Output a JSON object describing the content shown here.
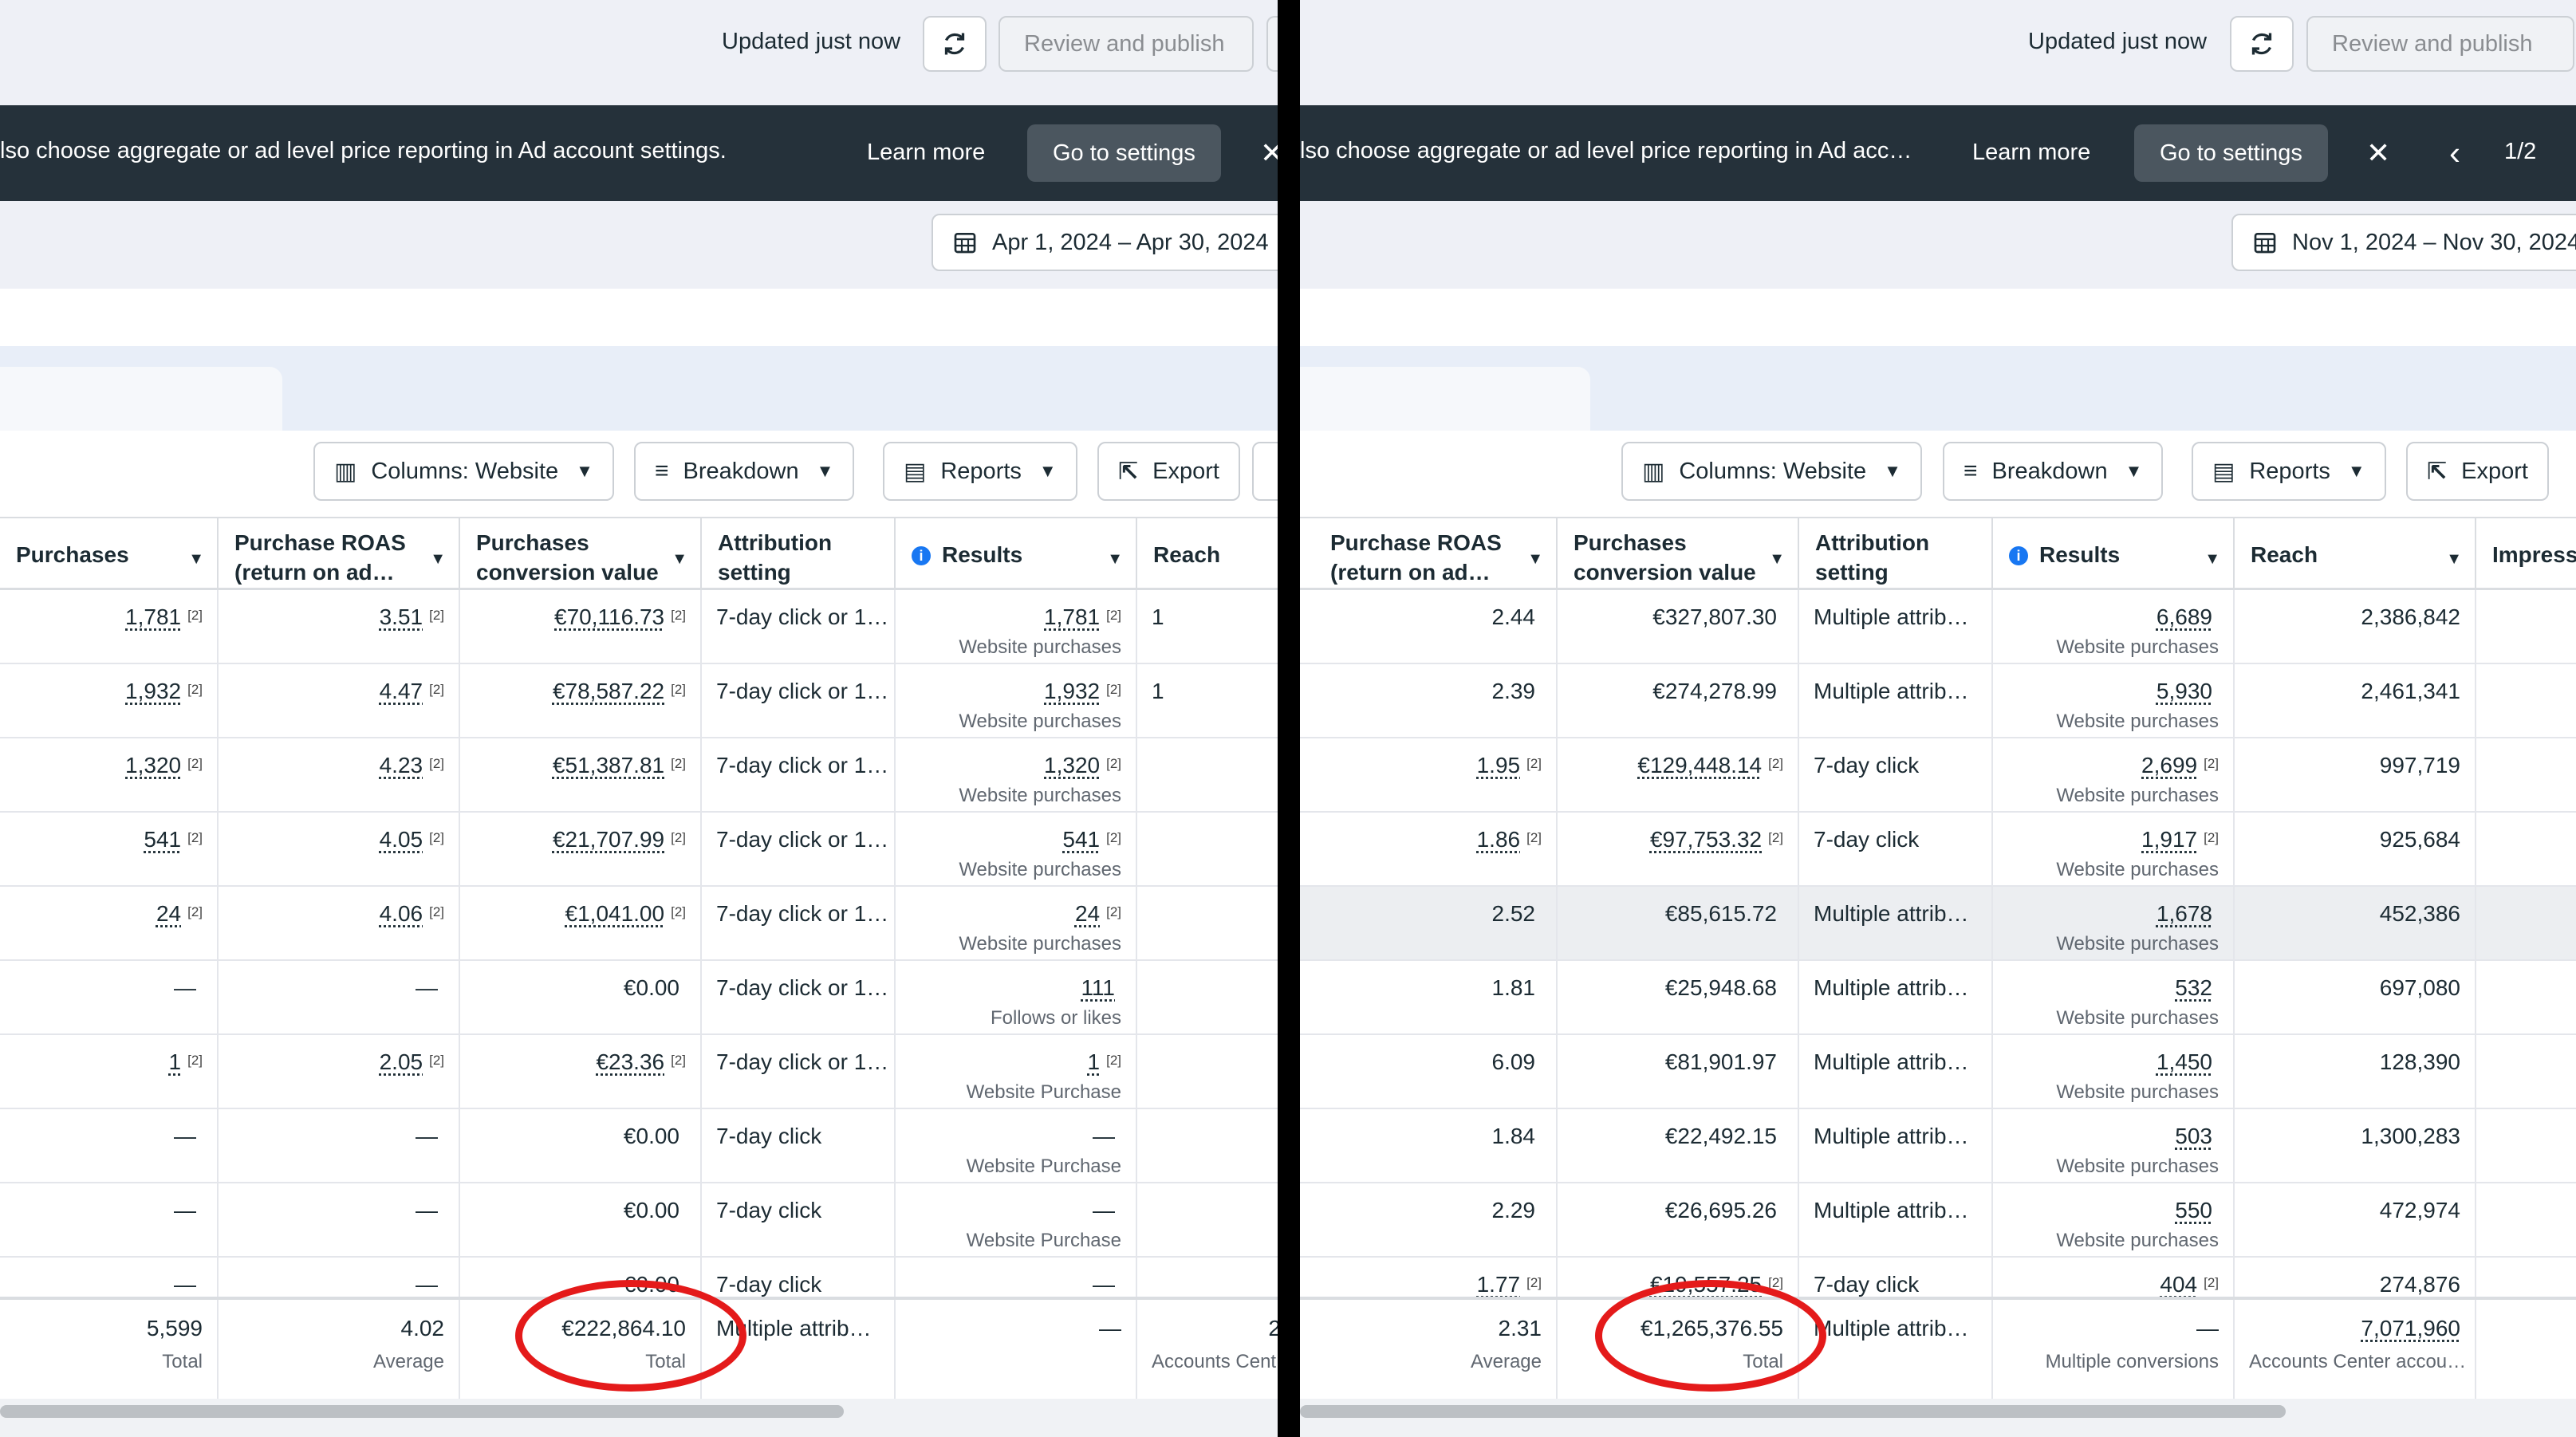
{
  "left": {
    "header": {
      "updated": "Updated just now",
      "publish": "Review and publish"
    },
    "banner": {
      "text": "lso choose aggregate or ad level price reporting in Ad account settings.",
      "learn_more": "Learn more",
      "go_to_settings": "Go to settings",
      "close": "✕"
    },
    "date_range": "Apr 1, 2024 – Apr 30, 2024",
    "toolbar": {
      "columns": "Columns: Website",
      "breakdown": "Breakdown",
      "reports": "Reports",
      "export": "Export"
    },
    "columns": {
      "purchases": "Purchases",
      "roas": "Purchase ROAS (return on ad…",
      "conv_value": "Purchases conversion value",
      "attribution": "Attribution setting",
      "results": "Results",
      "reach": "Reach"
    },
    "rows": [
      {
        "purchases": "1,781",
        "p_sup": "[2]",
        "roas": "3.51",
        "r_sup": "[2]",
        "value": "€70,116.73",
        "v_sup": "[2]",
        "attr": "7-day click or 1…",
        "result": "1,781",
        "res_sup": "[2]",
        "result_type": "Website purchases",
        "reach": "1"
      },
      {
        "purchases": "1,932",
        "p_sup": "[2]",
        "roas": "4.47",
        "r_sup": "[2]",
        "value": "€78,587.22",
        "v_sup": "[2]",
        "attr": "7-day click or 1…",
        "result": "1,932",
        "res_sup": "[2]",
        "result_type": "Website purchases",
        "reach": "1"
      },
      {
        "purchases": "1,320",
        "p_sup": "[2]",
        "roas": "4.23",
        "r_sup": "[2]",
        "value": "€51,387.81",
        "v_sup": "[2]",
        "attr": "7-day click or 1…",
        "result": "1,320",
        "res_sup": "[2]",
        "result_type": "Website purchases",
        "reach": ""
      },
      {
        "purchases": "541",
        "p_sup": "[2]",
        "roas": "4.05",
        "r_sup": "[2]",
        "value": "€21,707.99",
        "v_sup": "[2]",
        "attr": "7-day click or 1…",
        "result": "541",
        "res_sup": "[2]",
        "result_type": "Website purchases",
        "reach": ""
      },
      {
        "purchases": "24",
        "p_sup": "[2]",
        "roas": "4.06",
        "r_sup": "[2]",
        "value": "€1,041.00",
        "v_sup": "[2]",
        "attr": "7-day click or 1…",
        "result": "24",
        "res_sup": "[2]",
        "result_type": "Website purchases",
        "reach": ""
      },
      {
        "purchases": "—",
        "p_sup": "",
        "roas": "—",
        "r_sup": "",
        "value": "€0.00",
        "v_sup": "",
        "attr": "7-day click or 1…",
        "result": "111",
        "res_sup": "",
        "result_type": "Follows or likes",
        "reach": ""
      },
      {
        "purchases": "1",
        "p_sup": "[2]",
        "roas": "2.05",
        "r_sup": "[2]",
        "value": "€23.36",
        "v_sup": "[2]",
        "attr": "7-day click or 1…",
        "result": "1",
        "res_sup": "[2]",
        "result_type": "Website Purchase",
        "reach": ""
      },
      {
        "purchases": "—",
        "p_sup": "",
        "roas": "—",
        "r_sup": "",
        "value": "€0.00",
        "v_sup": "",
        "attr": "7-day click",
        "result": "—",
        "res_sup": "",
        "result_type": "Website Purchase",
        "reach": ""
      },
      {
        "purchases": "—",
        "p_sup": "",
        "roas": "—",
        "r_sup": "",
        "value": "€0.00",
        "v_sup": "",
        "attr": "7-day click",
        "result": "—",
        "res_sup": "",
        "result_type": "Website Purchase",
        "reach": ""
      },
      {
        "purchases": "—",
        "p_sup": "",
        "roas": "—",
        "r_sup": "",
        "value": "€0.00",
        "v_sup": "",
        "attr": "7-day click",
        "result": "—",
        "res_sup": "",
        "result_type": "",
        "reach": ""
      }
    ],
    "totals": {
      "purchases": "5,599",
      "purchases_label": "Total",
      "roas": "4.02",
      "roas_label": "Average",
      "value": "€222,864.10",
      "value_label": "Total",
      "attr": "Multiple attrib…",
      "result": "—",
      "reach": "2",
      "reach_label": "Accounts Cent"
    }
  },
  "right": {
    "header": {
      "updated": "Updated just now",
      "publish": "Review and publish"
    },
    "banner": {
      "text": "lso choose aggregate or ad level price reporting in Ad accou…",
      "learn_more": "Learn more",
      "go_to_settings": "Go to settings",
      "close": "✕",
      "prev": "‹",
      "pager": "1/2"
    },
    "date_range": "Nov 1, 2024 – Nov 30, 2024",
    "toolbar": {
      "columns": "Columns: Website",
      "breakdown": "Breakdown",
      "reports": "Reports",
      "export": "Export"
    },
    "columns": {
      "roas": "Purchase ROAS (return on ad…",
      "conv_value": "Purchases conversion value",
      "attribution": "Attribution setting",
      "results": "Results",
      "reach": "Reach",
      "impressions": "Impress"
    },
    "rows": [
      {
        "roas": "2.44",
        "r_sup": "",
        "value": "€327,807.30",
        "v_sup": "",
        "attr": "Multiple attrib…",
        "result": "6,689",
        "res_sup": "",
        "result_type": "Website purchases",
        "reach": "2,386,842"
      },
      {
        "roas": "2.39",
        "r_sup": "",
        "value": "€274,278.99",
        "v_sup": "",
        "attr": "Multiple attrib…",
        "result": "5,930",
        "res_sup": "",
        "result_type": "Website purchases",
        "reach": "2,461,341"
      },
      {
        "roas": "1.95",
        "r_sup": "[2]",
        "value": "€129,448.14",
        "v_sup": "[2]",
        "attr": "7-day click",
        "result": "2,699",
        "res_sup": "[2]",
        "result_type": "Website purchases",
        "reach": "997,719"
      },
      {
        "roas": "1.86",
        "r_sup": "[2]",
        "value": "€97,753.32",
        "v_sup": "[2]",
        "attr": "7-day click",
        "result": "1,917",
        "res_sup": "[2]",
        "result_type": "Website purchases",
        "reach": "925,684"
      },
      {
        "roas": "2.52",
        "r_sup": "",
        "value": "€85,615.72",
        "v_sup": "",
        "attr": "Multiple attrib…",
        "result": "1,678",
        "res_sup": "",
        "result_type": "Website purchases",
        "reach": "452,386"
      },
      {
        "roas": "1.81",
        "r_sup": "",
        "value": "€25,948.68",
        "v_sup": "",
        "attr": "Multiple attrib…",
        "result": "532",
        "res_sup": "",
        "result_type": "Website purchases",
        "reach": "697,080"
      },
      {
        "roas": "6.09",
        "r_sup": "",
        "value": "€81,901.97",
        "v_sup": "",
        "attr": "Multiple attrib…",
        "result": "1,450",
        "res_sup": "",
        "result_type": "Website purchases",
        "reach": "128,390"
      },
      {
        "roas": "1.84",
        "r_sup": "",
        "value": "€22,492.15",
        "v_sup": "",
        "attr": "Multiple attrib…",
        "result": "503",
        "res_sup": "",
        "result_type": "Website purchases",
        "reach": "1,300,283"
      },
      {
        "roas": "2.29",
        "r_sup": "",
        "value": "€26,695.26",
        "v_sup": "",
        "attr": "Multiple attrib…",
        "result": "550",
        "res_sup": "",
        "result_type": "Website purchases",
        "reach": "472,974"
      },
      {
        "roas": "1.77",
        "r_sup": "[2]",
        "value": "€19,557.25",
        "v_sup": "[2]",
        "attr": "7-day click",
        "result": "404",
        "res_sup": "[2]",
        "result_type": "",
        "reach": "274,876"
      }
    ],
    "totals": {
      "roas": "2.31",
      "roas_label": "Average",
      "value": "€1,265,376.55",
      "value_label": "Total",
      "attr": "Multiple attrib…",
      "result": "—",
      "result_label": "Multiple conversions",
      "reach": "7,071,960",
      "reach_label": "Accounts Center accou…"
    }
  },
  "colors": {
    "banner": "#25313a",
    "annotation": "#e41a1a",
    "accent": "#1877f2",
    "topbar": "#eef0f6"
  },
  "icons": [
    "refresh-icon",
    "calendar-icon",
    "columns-icon",
    "breakdown-icon",
    "reports-icon",
    "export-icon",
    "info-icon",
    "close-icon",
    "chevron-left-icon",
    "caret-down-icon"
  ]
}
